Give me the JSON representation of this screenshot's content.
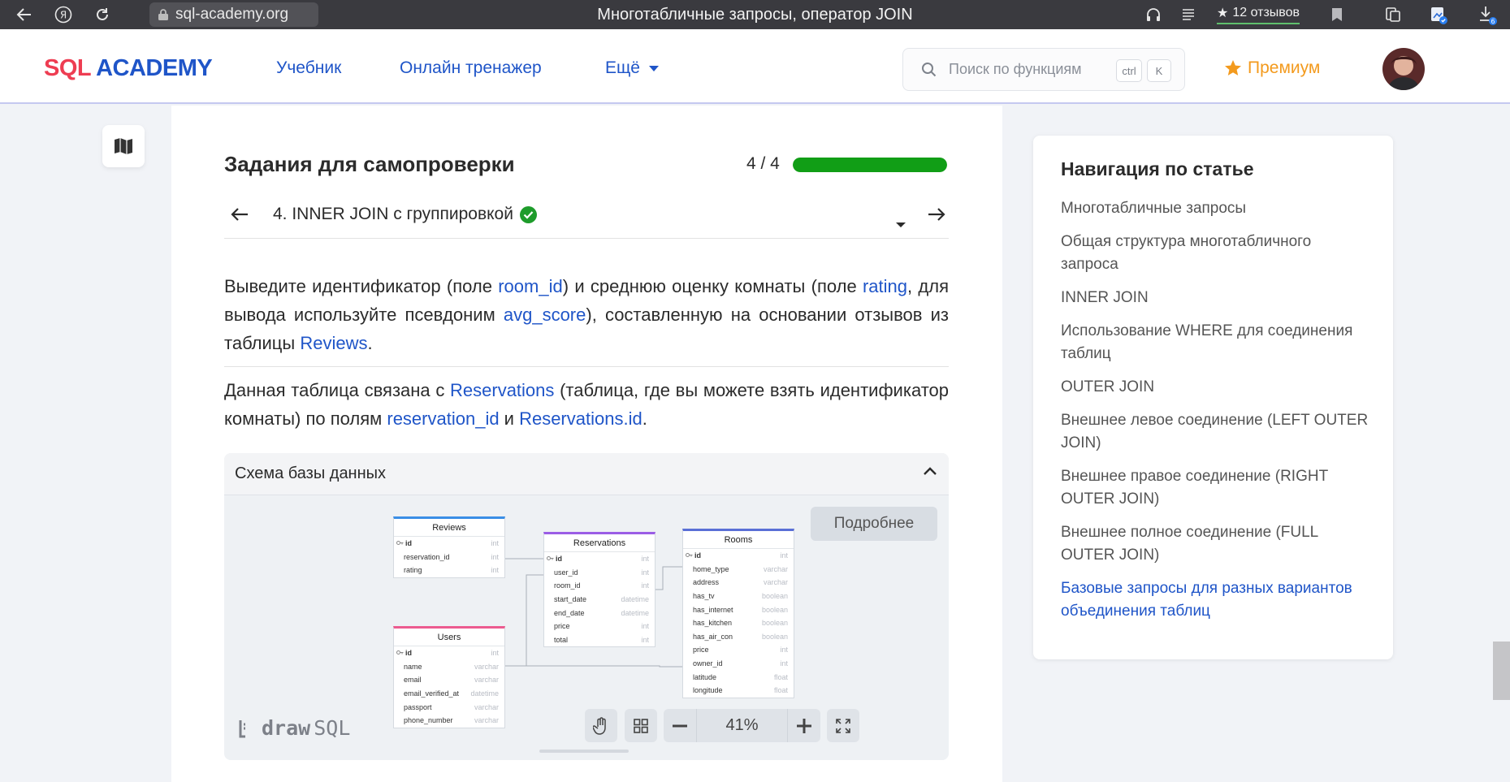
{
  "browser": {
    "url": "sql-academy.org",
    "window_title": "Многотабличные запросы, оператор JOIN",
    "reviews_label": "12 отзывов",
    "notification_count": "6"
  },
  "header": {
    "logo_left": "SQL",
    "logo_right": "ACADEMY",
    "nav": [
      "Учебник",
      "Онлайн тренажер",
      "Ещё"
    ],
    "search_placeholder": "Поиск по функциям",
    "kbd_ctrl": "ctrl",
    "kbd_k": "K",
    "premium": "Премиум"
  },
  "task": {
    "section_title": "Задания для самопроверки",
    "progress_text": "4 / 4",
    "progress_value": 1.0,
    "current_task": "4. INNER JOIN с группировкой",
    "p1": {
      "a": "Выведите идентификатор (поле ",
      "l1": "room_id",
      "b": ") и среднюю оценку комнаты (поле ",
      "l2": "rating",
      "c": ", для вывода используйте псевдоним ",
      "l3": "avg_score",
      "d": "), составленную на основании отзывов из таблицы ",
      "l4": "Reviews",
      "e": "."
    },
    "p2": {
      "a": "Данная таблица связана с ",
      "l1": "Reservations",
      "b": " (таблица, где вы можете взять идентификатор комнаты) по полям ",
      "l2": "reservation_id",
      "c": " и ",
      "l3": "Reservations.id",
      "d": "."
    }
  },
  "schema": {
    "title": "Схема базы данных",
    "more_button": "Подробнее",
    "zoom": "41%",
    "brand_a": "draw",
    "brand_b": "SQL",
    "tables": {
      "reviews": {
        "name": "Reviews",
        "color": "#3a8ee6",
        "rows": [
          [
            "id",
            "int"
          ],
          [
            "reservation_id",
            "int"
          ],
          [
            "rating",
            "int"
          ]
        ]
      },
      "reservations": {
        "name": "Reservations",
        "color": "#9b5de5",
        "rows": [
          [
            "id",
            "int"
          ],
          [
            "user_id",
            "int"
          ],
          [
            "room_id",
            "int"
          ],
          [
            "start_date",
            "datetime"
          ],
          [
            "end_date",
            "datetime"
          ],
          [
            "price",
            "int"
          ],
          [
            "total",
            "int"
          ]
        ]
      },
      "rooms": {
        "name": "Rooms",
        "color": "#5a6fd6",
        "rows": [
          [
            "id",
            "int"
          ],
          [
            "home_type",
            "varchar"
          ],
          [
            "address",
            "varchar"
          ],
          [
            "has_tv",
            "boolean"
          ],
          [
            "has_internet",
            "boolean"
          ],
          [
            "has_kitchen",
            "boolean"
          ],
          [
            "has_air_con",
            "boolean"
          ],
          [
            "price",
            "int"
          ],
          [
            "owner_id",
            "int"
          ],
          [
            "latitude",
            "float"
          ],
          [
            "longitude",
            "float"
          ]
        ]
      },
      "users": {
        "name": "Users",
        "color": "#ec5b8f",
        "rows": [
          [
            "id",
            "int"
          ],
          [
            "name",
            "varchar"
          ],
          [
            "email",
            "varchar"
          ],
          [
            "email_verified_at",
            "datetime"
          ],
          [
            "passport",
            "varchar"
          ],
          [
            "phone_number",
            "varchar"
          ]
        ]
      }
    }
  },
  "sidebar": {
    "title": "Навигация по статье",
    "items": [
      "Многотабличные запросы",
      "Общая структура многотабличного запроса",
      "INNER JOIN",
      "Использование WHERE для соединения таблиц",
      "OUTER JOIN",
      "Внешнее левое соединение (LEFT OUTER JOIN)",
      "Внешнее правое соединение (RIGHT OUTER JOIN)",
      "Внешнее полное соединение (FULL OUTER JOIN)",
      "Базовые запросы для разных вариантов объединения таблиц"
    ],
    "active_index": 8
  },
  "icons": [
    "back-arrow-icon",
    "yandex-icon",
    "reload-icon",
    "lock-icon",
    "headphones-icon",
    "reader-icon",
    "star-icon",
    "bookmark-icon",
    "collections-icon",
    "extension-icon",
    "download-icon",
    "search-icon",
    "chevron-down-icon",
    "map-icon",
    "arrow-left-icon",
    "arrow-right-icon",
    "check-circle-icon",
    "dropdown-caret-icon",
    "chevron-up-icon",
    "hand-icon",
    "grid-icon",
    "minus-icon",
    "plus-icon",
    "fullscreen-icon"
  ]
}
